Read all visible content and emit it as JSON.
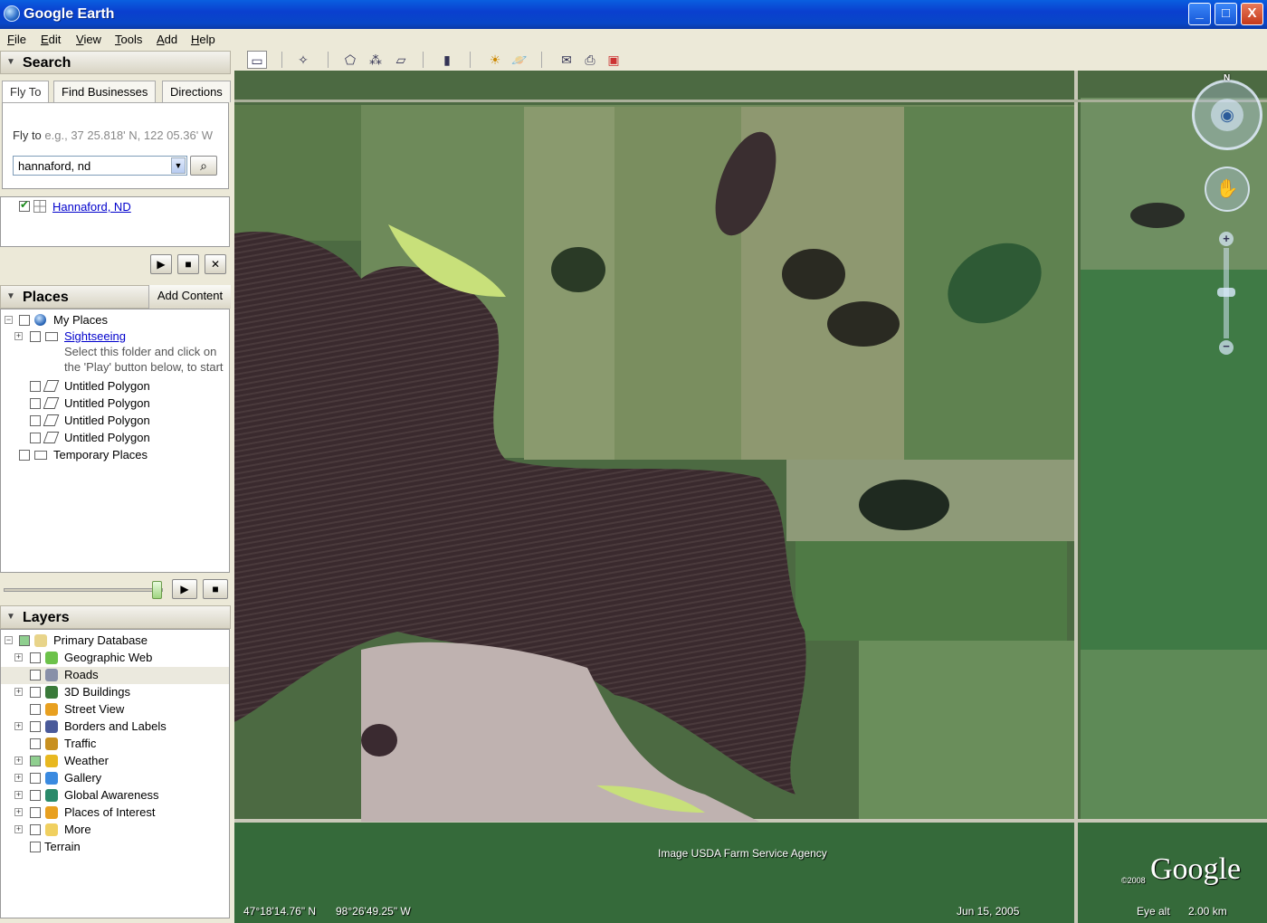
{
  "window": {
    "title": "Google Earth",
    "min": "_",
    "max": "□",
    "close": "X"
  },
  "menu": [
    "File",
    "Edit",
    "View",
    "Tools",
    "Add",
    "Help"
  ],
  "search": {
    "header": "Search",
    "tabs": [
      "Fly To",
      "Find Businesses",
      "Directions"
    ],
    "fly_to_label": "Fly to",
    "fly_to_hint": "e.g., 37 25.818' N, 122 05.36' W",
    "query": "hannaford, nd",
    "result": "Hannaford, ND"
  },
  "places": {
    "header": "Places",
    "add_content": "Add Content",
    "items": [
      {
        "label": "My Places"
      },
      {
        "label": "Sightseeing"
      },
      {
        "label": "Select this folder and click on"
      },
      {
        "label": "the 'Play' button below, to start"
      },
      {
        "label": "Untitled Polygon"
      },
      {
        "label": "Untitled Polygon"
      },
      {
        "label": "Untitled Polygon"
      },
      {
        "label": "Untitled Polygon"
      },
      {
        "label": "Temporary Places"
      }
    ]
  },
  "layers": {
    "header": "Layers",
    "items": [
      {
        "label": "Primary Database"
      },
      {
        "label": "Geographic Web"
      },
      {
        "label": "Roads"
      },
      {
        "label": "3D Buildings"
      },
      {
        "label": "Street View"
      },
      {
        "label": "Borders and Labels"
      },
      {
        "label": "Traffic"
      },
      {
        "label": "Weather"
      },
      {
        "label": "Gallery"
      },
      {
        "label": "Global Awareness"
      },
      {
        "label": "Places of Interest"
      },
      {
        "label": "More"
      },
      {
        "label": "Terrain"
      }
    ]
  },
  "map": {
    "attribution": "Image USDA Farm Service Agency",
    "latitude": "47°18'14.76\" N",
    "longitude": "98°26'49.25\" W",
    "date": "Jun 15, 2005",
    "eye_alt_label": "Eye alt",
    "eye_alt_value": "2.00 km",
    "copyright": "©2008",
    "brand": "Google",
    "north": "N"
  },
  "colors": {
    "titlebar": "#0a4fd6",
    "panel": "#ece9d8",
    "link": "#0000cc"
  }
}
